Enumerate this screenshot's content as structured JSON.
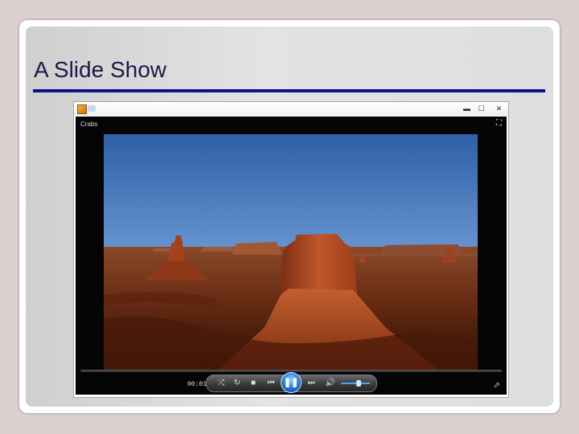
{
  "slide": {
    "title": "A Slide Show"
  },
  "player": {
    "now_playing": "Crabs",
    "time": "00:01",
    "volume_level": 0.6,
    "window_controls": {
      "minimize": "▬",
      "maximize": "☐",
      "close": "✕"
    },
    "icons": {
      "shuffle": "⤮",
      "repeat": "↻",
      "stop": "■",
      "previous": "⏮",
      "pause": "❚❚",
      "next": "⏭",
      "volume": "🔊",
      "fullscreen": "⛶",
      "switch_to_library": "⬀"
    },
    "colors": {
      "accent": "#1a6fd6",
      "title_rule": "#0d1190"
    }
  }
}
